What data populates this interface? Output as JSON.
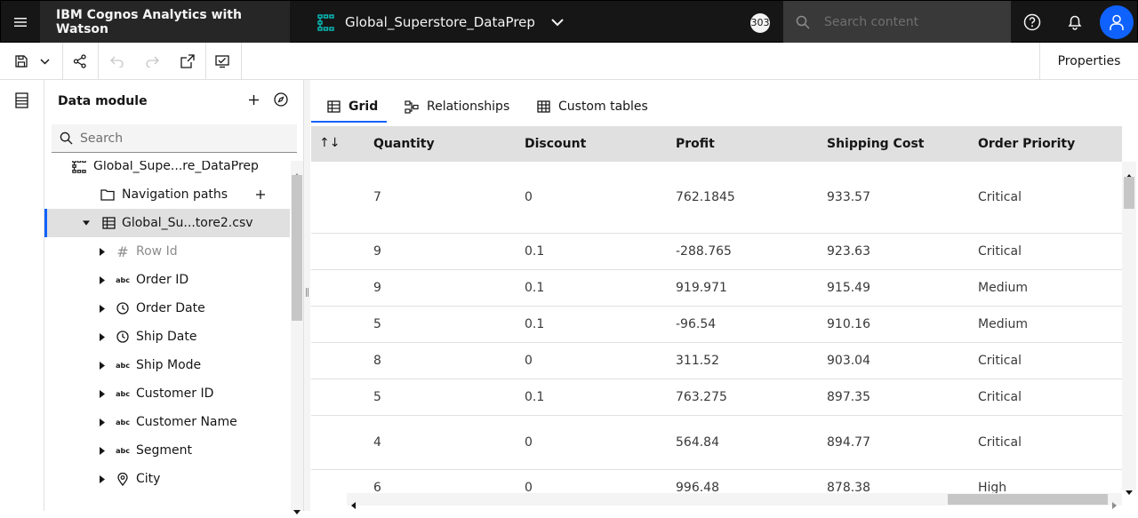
{
  "topbar": {
    "app_name": "IBM Cognos Analytics with Watson",
    "dataset_name": "Global_Superstore_DataPrep",
    "notification_badge": "303",
    "search_placeholder": "Search content"
  },
  "toolbar": {
    "properties_label": "Properties"
  },
  "left_panel": {
    "title": "Data module",
    "search_placeholder": "Search",
    "tree": [
      {
        "label": "Global_Supe...re_DataPrep",
        "icon": "module-icon"
      },
      {
        "label": "Navigation paths",
        "icon": "folder-icon"
      },
      {
        "label": "Global_Su...tore2.csv",
        "icon": "table-icon"
      },
      {
        "label": "Row Id",
        "icon": "hash-icon"
      },
      {
        "label": "Order ID",
        "icon": "abc-icon"
      },
      {
        "label": "Order Date",
        "icon": "clock-icon"
      },
      {
        "label": "Ship Date",
        "icon": "clock-icon"
      },
      {
        "label": "Ship Mode",
        "icon": "abc-icon"
      },
      {
        "label": "Customer ID",
        "icon": "abc-icon"
      },
      {
        "label": "Customer Name",
        "icon": "abc-icon"
      },
      {
        "label": "Segment",
        "icon": "abc-icon"
      },
      {
        "label": "City",
        "icon": "location-icon"
      }
    ],
    "abc_text": "abc",
    "hash_text": "#"
  },
  "tabs": [
    {
      "label": "Grid"
    },
    {
      "label": "Relationships"
    },
    {
      "label": "Custom tables"
    }
  ],
  "grid": {
    "sort_symbol": "↑↓",
    "columns": [
      "Quantity",
      "Discount",
      "Profit",
      "Shipping Cost",
      "Order Priority"
    ],
    "rows": [
      [
        "7",
        "0",
        "762.1845",
        "933.57",
        "Critical"
      ],
      [
        "9",
        "0.1",
        "-288.765",
        "923.63",
        "Critical"
      ],
      [
        "9",
        "0.1",
        "919.971",
        "915.49",
        "Medium"
      ],
      [
        "5",
        "0.1",
        "-96.54",
        "910.16",
        "Medium"
      ],
      [
        "8",
        "0",
        "311.52",
        "903.04",
        "Critical"
      ],
      [
        "5",
        "0.1",
        "763.275",
        "897.35",
        "Critical"
      ],
      [
        "4",
        "0",
        "564.84",
        "894.77",
        "Critical"
      ],
      [
        "6",
        "0",
        "996.48",
        "878.38",
        "High"
      ]
    ]
  },
  "colors": {
    "accent": "#0f62fe",
    "topbar_bg": "#161616"
  }
}
